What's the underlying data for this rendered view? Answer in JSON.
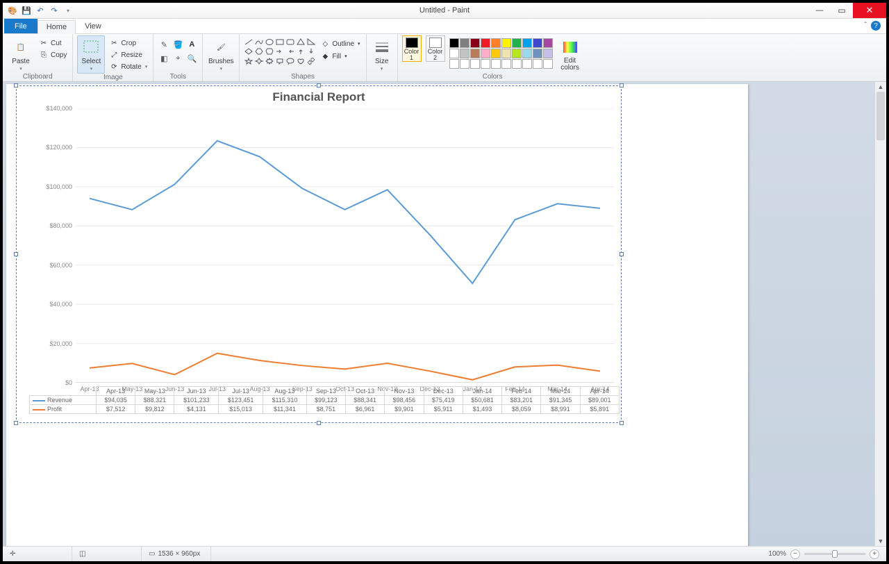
{
  "window": {
    "title": "Untitled - Paint"
  },
  "tabs": {
    "file": "File",
    "home": "Home",
    "view": "View"
  },
  "ribbon": {
    "clipboard": {
      "label": "Clipboard",
      "paste": "Paste",
      "cut": "Cut",
      "copy": "Copy"
    },
    "image": {
      "label": "Image",
      "select": "Select",
      "crop": "Crop",
      "resize": "Resize",
      "rotate": "Rotate"
    },
    "tools": {
      "label": "Tools"
    },
    "brushes": {
      "label": "Brushes",
      "btn": "Brushes"
    },
    "shapes": {
      "label": "Shapes",
      "outline": "Outline",
      "fill": "Fill"
    },
    "size": {
      "label": "Size",
      "btn": "Size"
    },
    "colors": {
      "label": "Colors",
      "c1": "Color\n1",
      "c2": "Color\n2",
      "edit": "Edit\ncolors"
    },
    "palette_colors": [
      "#000000",
      "#7f7f7f",
      "#880015",
      "#ed1c24",
      "#ff7f27",
      "#fff200",
      "#22b14c",
      "#00a2e8",
      "#3f48cc",
      "#a349a4",
      "#ffffff",
      "#c3c3c3",
      "#b97a57",
      "#ffaec9",
      "#ffc90e",
      "#efe4b0",
      "#b5e61d",
      "#99d9ea",
      "#7092be",
      "#c8bfe7"
    ]
  },
  "status": {
    "dims": "1536 × 960px",
    "zoom": "100%"
  },
  "chart_data": {
    "type": "line",
    "title": "Financial Report",
    "categories": [
      "Apr-13",
      "May-13",
      "Jun-13",
      "Jul-13",
      "Aug-13",
      "Sep-13",
      "Oct-13",
      "Nov-13",
      "Dec-13",
      "Jan-14",
      "Feb-14",
      "Mar-14",
      "Apr-14"
    ],
    "series": [
      {
        "name": "Revenue",
        "color": "#5b9bd5",
        "values": [
          94035,
          88321,
          101233,
          123451,
          115310,
          99123,
          88341,
          98456,
          75419,
          50681,
          83201,
          91345,
          89001
        ],
        "labels": [
          "$94,035",
          "$88,321",
          "$101,233",
          "$123,451",
          "$115,310",
          "$99,123",
          "$88,341",
          "$98,456",
          "$75,419",
          "$50,681",
          "$83,201",
          "$91,345",
          "$89,001"
        ]
      },
      {
        "name": "Profit",
        "color": "#ed7d31",
        "values": [
          7512,
          9812,
          4131,
          15013,
          11341,
          8751,
          6961,
          9901,
          5911,
          1493,
          8059,
          8991,
          5891
        ],
        "labels": [
          "$7,512",
          "$9,812",
          "$4,131",
          "$15,013",
          "$11,341",
          "$8,751",
          "$6,961",
          "$9,901",
          "$5,911",
          "$1,493",
          "$8,059",
          "$8,991",
          "$5,891"
        ]
      }
    ],
    "ylim": [
      0,
      140000
    ],
    "yticks": [
      "$0",
      "$20,000",
      "$40,000",
      "$60,000",
      "$80,000",
      "$100,000",
      "$120,000",
      "$140,000"
    ],
    "xlabel": "",
    "ylabel": ""
  }
}
